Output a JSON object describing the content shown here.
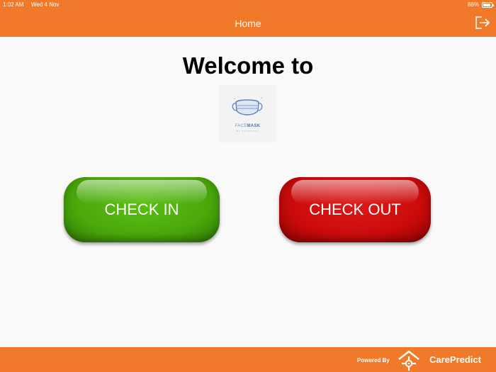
{
  "status": {
    "time": "1:02 AM",
    "date": "Wed 4 Nov",
    "battery_text": "88%",
    "battery_level": 0.88
  },
  "header": {
    "title": "Home",
    "logout_icon": "logout-icon"
  },
  "main": {
    "welcome": "Welcome to",
    "logo": {
      "word1": "FACE",
      "word2": "MASK",
      "tagline": "BY ANYTHING"
    },
    "check_in_label": "CHECK IN",
    "check_out_label": "CHECK OUT"
  },
  "footer": {
    "powered_by": "Powered By",
    "brand": "CarePredict",
    "brand_icon": "carepredict-logo-icon"
  },
  "colors": {
    "accent": "#f07a2a",
    "check_in": "#4aa80b",
    "check_out": "#cb0b0b"
  }
}
